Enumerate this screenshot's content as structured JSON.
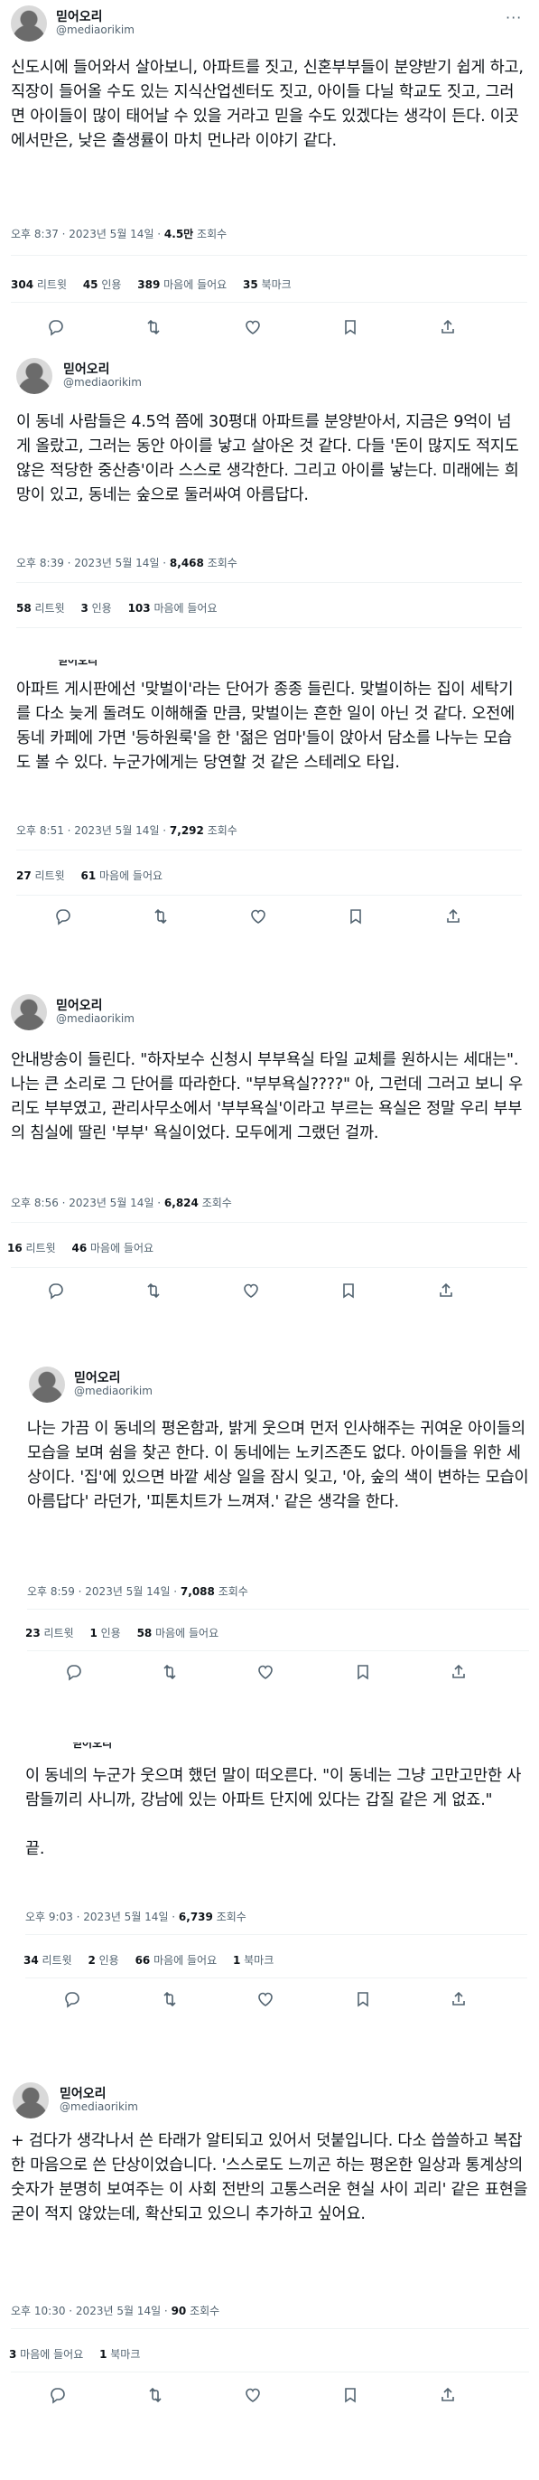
{
  "author": {
    "name": "믿어오리",
    "handle": "@mediaorikim"
  },
  "tweets": [
    {
      "text": "신도시에 들어와서 살아보니, 아파트를 짓고, 신혼부부들이 분양받기 쉽게 하고, 직장이 들어올 수도 있는 지식산업센터도 짓고, 아이들 다닐 학교도 짓고, 그러면 아이들이 많이 태어날 수 있을 거라고 믿을 수도 있겠다는 생각이 든다. 이곳에서만은, 낮은 출생률이 마치 먼나라 이야기 같다.",
      "time": "오후 8:37 · 2023년 5월 14일 · ",
      "views": "4.5만",
      "views_label": " 조회수",
      "stats": [
        {
          "num": "304",
          "label": " 리트윗"
        },
        {
          "num": "45",
          "label": " 인용"
        },
        {
          "num": "389",
          "label": " 마음에 들어요"
        },
        {
          "num": "35",
          "label": " 북마크"
        }
      ]
    },
    {
      "text": "이 동네 사람들은 4.5억 쯤에 30평대 아파트를 분양받아서, 지금은 9억이 넘게 올랐고, 그러는 동안 아이를 낳고 살아온 것 같다. 다들 '돈이 많지도 적지도 않은 적당한 중산층'이라 스스로 생각한다. 그리고 아이를 낳는다. 미래에는 희망이 있고, 동네는 숲으로 둘러싸여 아름답다.",
      "time": "오후 8:39 · 2023년 5월 14일 · ",
      "views": "8,468",
      "views_label": " 조회수",
      "stats": [
        {
          "num": "58",
          "label": " 리트윗"
        },
        {
          "num": "3",
          "label": " 인용"
        },
        {
          "num": "103",
          "label": " 마음에 들어요"
        }
      ]
    },
    {
      "text": "아파트 게시판에선 '맞벌이'라는 단어가 종종 들린다. 맞벌이하는 집이 세탁기를 다소 늦게 돌려도 이해해줄 만큼, 맞벌이는 흔한 일이 아닌 것 같다. 오전에 동네 카페에 가면 '등하원룩'을 한 '젊은 엄마'들이 앉아서 담소를 나누는 모습도 볼 수 있다. 누군가에게는 당연할 것 같은 스테레오 타입.",
      "time": "오후 8:51 · 2023년 5월 14일 · ",
      "views": "7,292",
      "views_label": " 조회수",
      "stats": [
        {
          "num": "27",
          "label": " 리트윗"
        },
        {
          "num": "61",
          "label": " 마음에 들어요"
        }
      ]
    },
    {
      "text": "안내방송이 들린다. \"하자보수 신청시 부부욕실 타일 교체를 원하시는 세대는\". 나는 큰 소리로 그 단어를 따라한다. \"부부욕실????\" 아, 그런데 그러고 보니 우리도 부부였고, 관리사무소에서 '부부욕실'이라고 부르는 욕실은 정말 우리 부부의 침실에 딸린 '부부' 욕실이었다. 모두에게 그랬던 걸까.",
      "time": "오후 8:56 · 2023년 5월 14일 · ",
      "views": "6,824",
      "views_label": " 조회수",
      "stats": [
        {
          "num": "16",
          "label": " 리트윗"
        },
        {
          "num": "46",
          "label": " 마음에 들어요"
        }
      ]
    },
    {
      "text": "나는 가끔 이 동네의 평온함과, 밝게 웃으며 먼저 인사해주는 귀여운 아이들의 모습을 보며 쉼을 찾곤 한다. 이 동네에는 노키즈존도 없다. 아이들을 위한 세상이다. '집'에 있으면 바깥 세상 일을 잠시 잊고, '아, 숲의 색이 변하는 모습이 아름답다' 라던가, '피톤치트가 느껴져.' 같은 생각을 한다.",
      "time": "오후 8:59 · 2023년 5월 14일 · ",
      "views": "7,088",
      "views_label": " 조회수",
      "stats": [
        {
          "num": "23",
          "label": " 리트윗"
        },
        {
          "num": "1",
          "label": " 인용"
        },
        {
          "num": "58",
          "label": " 마음에 들어요"
        }
      ]
    },
    {
      "text": "이 동네의 누군가 웃으며 했던 말이 떠오른다. \"이 동네는 그냥 고만고만한 사람들끼리 사니까, 강남에 있는 아파트 단지에 있다는 갑질 같은 게 없죠.\"\n\n끝.",
      "time": "오후 9:03 · 2023년 5월 14일 · ",
      "views": "6,739",
      "views_label": " 조회수",
      "stats": [
        {
          "num": "34",
          "label": " 리트윗"
        },
        {
          "num": "2",
          "label": " 인용"
        },
        {
          "num": "66",
          "label": " 마음에 들어요"
        },
        {
          "num": "1",
          "label": " 북마크"
        }
      ]
    },
    {
      "text": "+ 검다가 생각나서 쓴 타래가 알티되고 있어서 덧붙입니다. 다소 씁쓸하고 복잡한 마음으로 쓴 단상이었습니다. '스스로도 느끼곤 하는 평온한 일상과 통계상의 숫자가 분명히 보여주는 이 사회 전반의 고통스러운 현실 사이 괴리' 같은 표현을 굳이 적지 않았는데, 확산되고 있으니 추가하고 싶어요.",
      "time": "오후 10:30 · 2023년 5월 14일 · ",
      "views": "90",
      "views_label": " 조회수",
      "stats": [
        {
          "num": "3",
          "label": " 마음에 들어요"
        },
        {
          "num": "1",
          "label": " 북마크"
        }
      ]
    }
  ]
}
